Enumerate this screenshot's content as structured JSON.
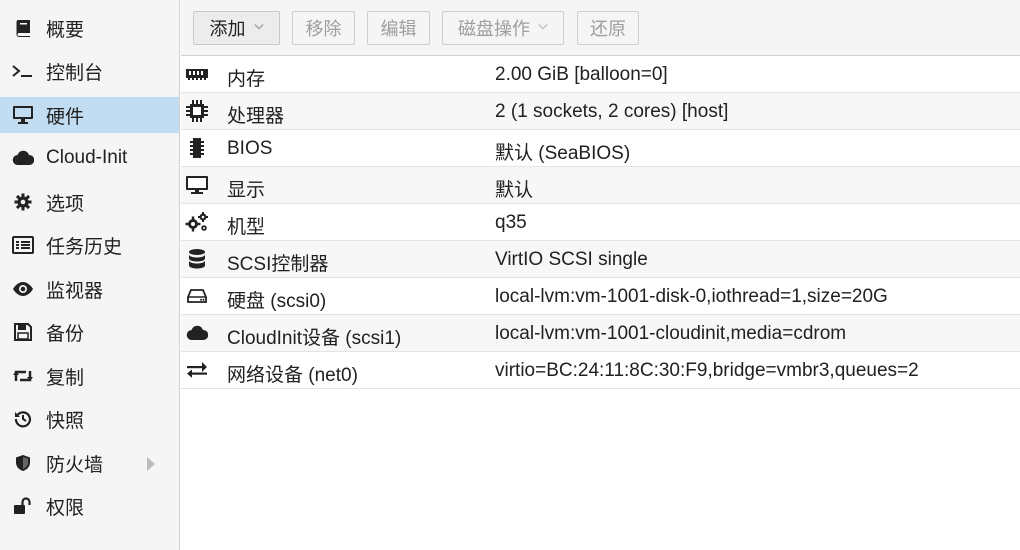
{
  "sidebar": {
    "items": [
      {
        "label": "概要",
        "icon": "book-icon"
      },
      {
        "label": "控制台",
        "icon": "terminal-icon"
      },
      {
        "label": "硬件",
        "icon": "desktop-icon",
        "selected": true
      },
      {
        "label": "Cloud-Init",
        "icon": "cloud-icon"
      },
      {
        "label": "选项",
        "icon": "gear-icon"
      },
      {
        "label": "任务历史",
        "icon": "list-icon"
      },
      {
        "label": "监视器",
        "icon": "eye-icon"
      },
      {
        "label": "备份",
        "icon": "floppy-icon"
      },
      {
        "label": "复制",
        "icon": "retweet-icon"
      },
      {
        "label": "快照",
        "icon": "history-icon"
      },
      {
        "label": "防火墙",
        "icon": "shield-icon",
        "expandable": true
      },
      {
        "label": "权限",
        "icon": "unlock-icon"
      }
    ]
  },
  "toolbar": {
    "add_label": "添加",
    "remove_label": "移除",
    "edit_label": "编辑",
    "disk_action_label": "磁盘操作",
    "revert_label": "还原"
  },
  "hardware": {
    "rows": [
      {
        "key": "内存",
        "value": "2.00 GiB [balloon=0]",
        "icon": "memory-icon"
      },
      {
        "key": "处理器",
        "value": "2 (1 sockets, 2 cores) [host]",
        "icon": "cpu-icon"
      },
      {
        "key": "BIOS",
        "value": "默认 (SeaBIOS)",
        "icon": "microchip-icon"
      },
      {
        "key": "显示",
        "value": "默认",
        "icon": "monitor-icon"
      },
      {
        "key": "机型",
        "value": "q35",
        "icon": "cogs-icon"
      },
      {
        "key": "SCSI控制器",
        "value": "VirtIO SCSI single",
        "icon": "database-icon"
      },
      {
        "key": "硬盘 (scsi0)",
        "value": "local-lvm:vm-1001-disk-0,iothread=1,size=20G",
        "icon": "hdd-icon"
      },
      {
        "key": "CloudInit设备 (scsi1)",
        "value": "local-lvm:vm-1001-cloudinit,media=cdrom",
        "icon": "cloud-icon"
      },
      {
        "key": "网络设备 (net0)",
        "value": "virtio=BC:24:11:8C:30:F9,bridge=vmbr3,queues=2",
        "icon": "exchange-icon"
      }
    ]
  },
  "colors": {
    "selected_bg": "#c2ddf2",
    "sidebar_bg": "#f5f5f5",
    "alt_row_bg": "#f7f7f7"
  }
}
